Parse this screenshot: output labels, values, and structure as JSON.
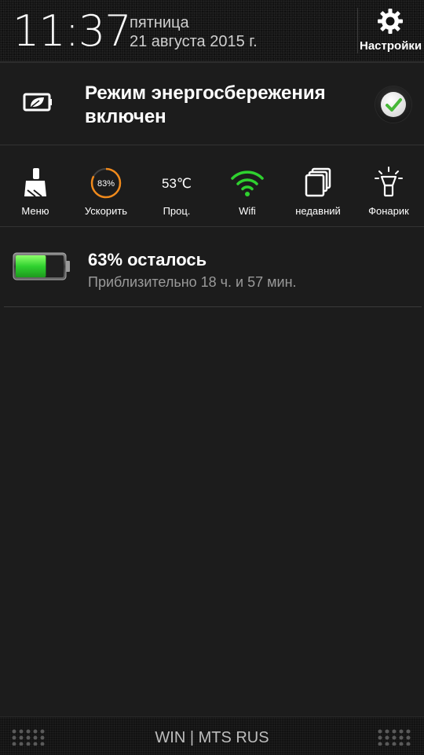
{
  "header": {
    "time": "11:37",
    "weekday": "пятница",
    "date": "21 августа 2015 г.",
    "settings_label": "Настройки"
  },
  "power_saving": {
    "text": "Режим энергосбережения включен",
    "enabled": true,
    "icon": "leaf-battery-icon"
  },
  "toggles": [
    {
      "label": "Меню",
      "icon": "broom-icon"
    },
    {
      "label": "Ускорить",
      "icon": "boost-ring-icon",
      "value": "83%",
      "fraction": 0.83
    },
    {
      "label": "Проц.",
      "icon": "cpu-temp",
      "value": "53℃"
    },
    {
      "label": "Wifi",
      "icon": "wifi-icon",
      "active": true
    },
    {
      "label": "недавний",
      "icon": "recent-apps-icon"
    },
    {
      "label": "Фонарик",
      "icon": "flashlight-icon"
    }
  ],
  "battery": {
    "title": "63% осталось",
    "subtitle": "Приблизительно 18 ч. и 57 мин.",
    "level": 0.63,
    "icon": "battery-icon"
  },
  "footer": {
    "carrier": "WIN | MTS RUS"
  },
  "colors": {
    "accent_green": "#2fd12f",
    "boost_orange": "#f08a1c",
    "background": "#1c1c1c"
  }
}
